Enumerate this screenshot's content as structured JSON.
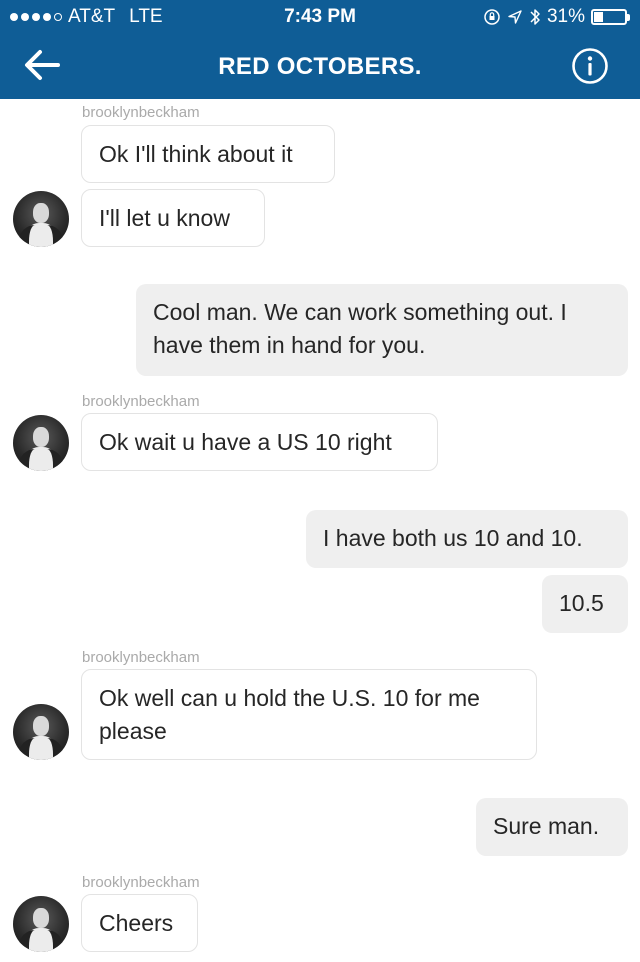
{
  "status_bar": {
    "carrier": "AT&T",
    "network": "LTE",
    "time": "7:43 PM",
    "battery": "31%",
    "battery_level": 0.31,
    "signal_bars": 4
  },
  "header": {
    "title": "RED OCTOBERS."
  },
  "messages": [
    {
      "sender": "brooklynbeckham",
      "text": "Ok I'll think about it",
      "direction": "incoming"
    },
    {
      "text": "I'll let u know",
      "direction": "incoming"
    },
    {
      "text": "Cool man. We can work something out. I have them in hand for you.",
      "direction": "outgoing"
    },
    {
      "sender": "brooklynbeckham",
      "text": "Ok wait u have a US 10 right",
      "direction": "incoming"
    },
    {
      "text": "I have both us 10 and 10.",
      "direction": "outgoing"
    },
    {
      "text": "10.5",
      "direction": "outgoing"
    },
    {
      "sender": "brooklynbeckham",
      "text": "Ok well can u hold the U.S. 10 for me please",
      "direction": "incoming"
    },
    {
      "text": "Sure man.",
      "direction": "outgoing"
    },
    {
      "sender": "brooklynbeckham",
      "text": "Cheers",
      "direction": "incoming"
    }
  ],
  "colors": {
    "header_bg": "#0f5d96",
    "outgoing_bubble": "#efefef",
    "incoming_border": "#e3e3e3",
    "sender_label": "#aaaaaa"
  }
}
